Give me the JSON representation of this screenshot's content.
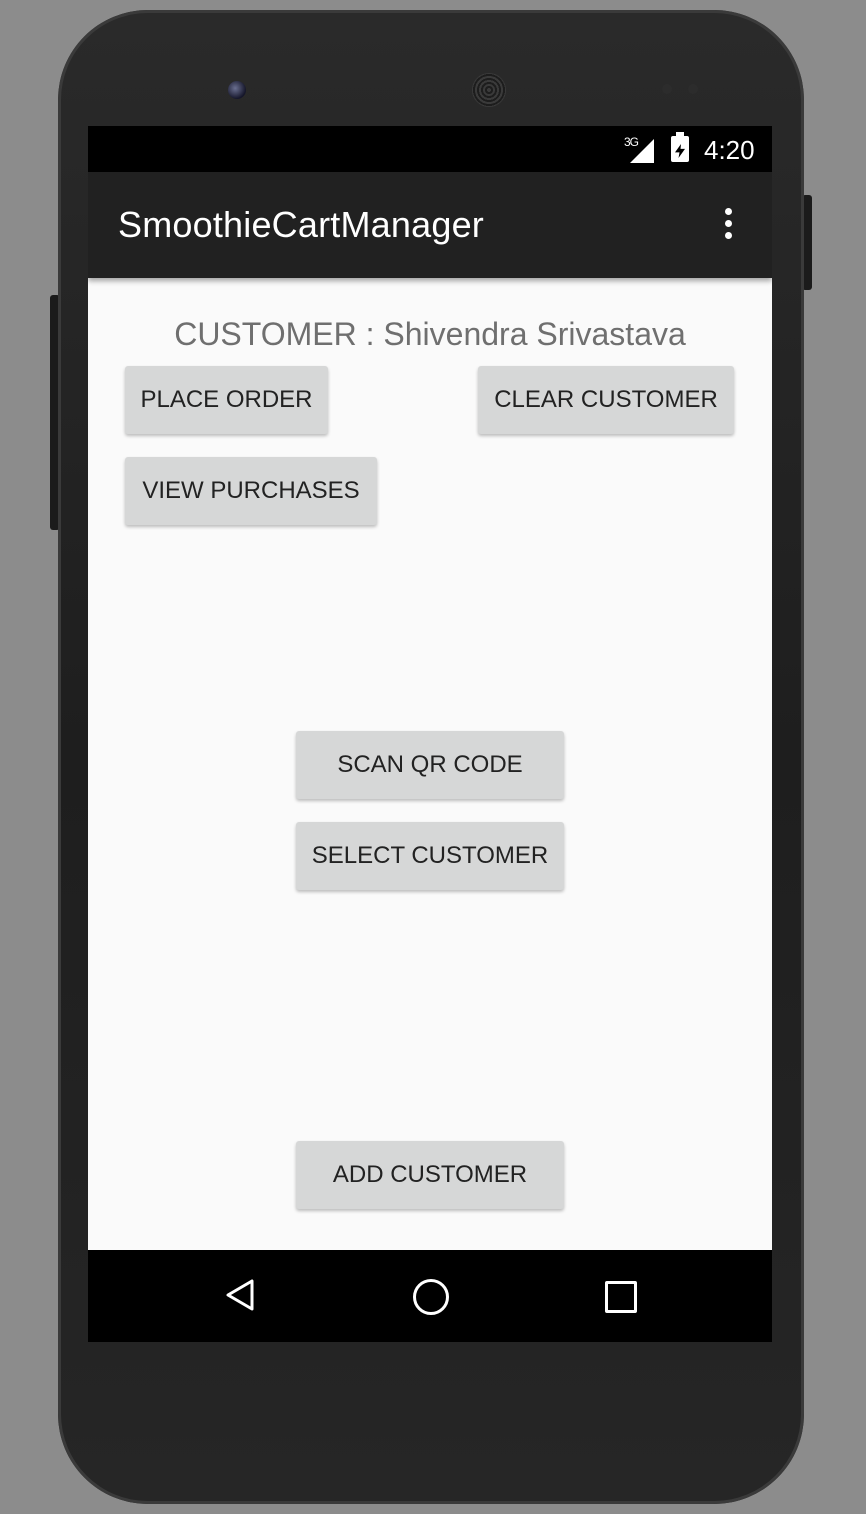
{
  "status_bar": {
    "network": "3G",
    "time": "4:20"
  },
  "app_bar": {
    "title": "SmoothieCartManager",
    "menu_icon": "more-vert-icon"
  },
  "main": {
    "customer_label": "CUSTOMER : Shivendra Srivastava",
    "buttons": {
      "place_order": "PLACE ORDER",
      "clear_customer": "CLEAR CUSTOMER",
      "view_purchases": "VIEW PURCHASES",
      "scan_qr": "SCAN QR CODE",
      "select_customer": "SELECT CUSTOMER",
      "add_customer": "ADD CUSTOMER"
    }
  },
  "nav_bar": {
    "back_icon": "back-triangle-icon",
    "home_icon": "home-circle-icon",
    "recents_icon": "recents-square-icon"
  },
  "colors": {
    "app_bar": "#212121",
    "background": "#fafafa",
    "button": "#d6d7d7",
    "label_text": "#6f6f6f"
  }
}
